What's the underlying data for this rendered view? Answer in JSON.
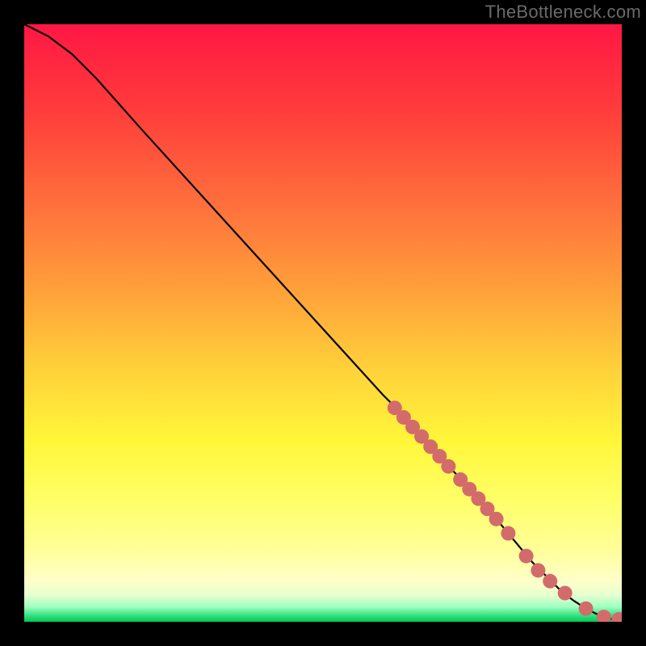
{
  "watermark": "TheBottleneck.com",
  "colors": {
    "marker": "#d36b6b",
    "curve": "#000000",
    "outer_bg": "#000000",
    "gradient_stops": [
      {
        "offset": 0.0,
        "color": "#ff1744"
      },
      {
        "offset": 0.14,
        "color": "#ff3b3b"
      },
      {
        "offset": 0.3,
        "color": "#ff6f3c"
      },
      {
        "offset": 0.45,
        "color": "#ffa23a"
      },
      {
        "offset": 0.58,
        "color": "#ffd23a"
      },
      {
        "offset": 0.7,
        "color": "#fff73a"
      },
      {
        "offset": 0.8,
        "color": "#ffff6a"
      },
      {
        "offset": 0.88,
        "color": "#ffff9a"
      },
      {
        "offset": 0.93,
        "color": "#ffffc8"
      },
      {
        "offset": 0.955,
        "color": "#e8ffd0"
      },
      {
        "offset": 0.975,
        "color": "#a0ffc0"
      },
      {
        "offset": 0.99,
        "color": "#30e080"
      },
      {
        "offset": 1.0,
        "color": "#00c853"
      }
    ]
  },
  "chart_data": {
    "type": "line",
    "title": "",
    "xlabel": "",
    "ylabel": "",
    "xlim": [
      0,
      100
    ],
    "ylim": [
      0,
      100
    ],
    "series": [
      {
        "name": "bottleneck-curve",
        "x": [
          0,
          4,
          8,
          12,
          20,
          30,
          40,
          50,
          60,
          65,
          70,
          75,
          80,
          85,
          88,
          90,
          92,
          94,
          96,
          98,
          100
        ],
        "y": [
          100,
          98,
          95,
          91,
          82,
          71,
          60,
          49,
          38,
          33,
          27,
          22,
          16,
          10,
          7,
          5,
          3.5,
          2.2,
          1.2,
          0.5,
          0.3
        ]
      }
    ],
    "markers": {
      "name": "data-points",
      "x": [
        62,
        63.5,
        65,
        66.5,
        68,
        69.5,
        71,
        73,
        74.5,
        76,
        77.5,
        79,
        81,
        84,
        86,
        88,
        90.5,
        94,
        97,
        99.5
      ],
      "y": [
        35.8,
        34.2,
        32.6,
        31.0,
        29.3,
        27.7,
        26.0,
        23.8,
        22.2,
        20.6,
        18.9,
        17.2,
        14.8,
        11.0,
        8.6,
        6.8,
        4.8,
        2.2,
        0.8,
        0.4
      ]
    }
  }
}
